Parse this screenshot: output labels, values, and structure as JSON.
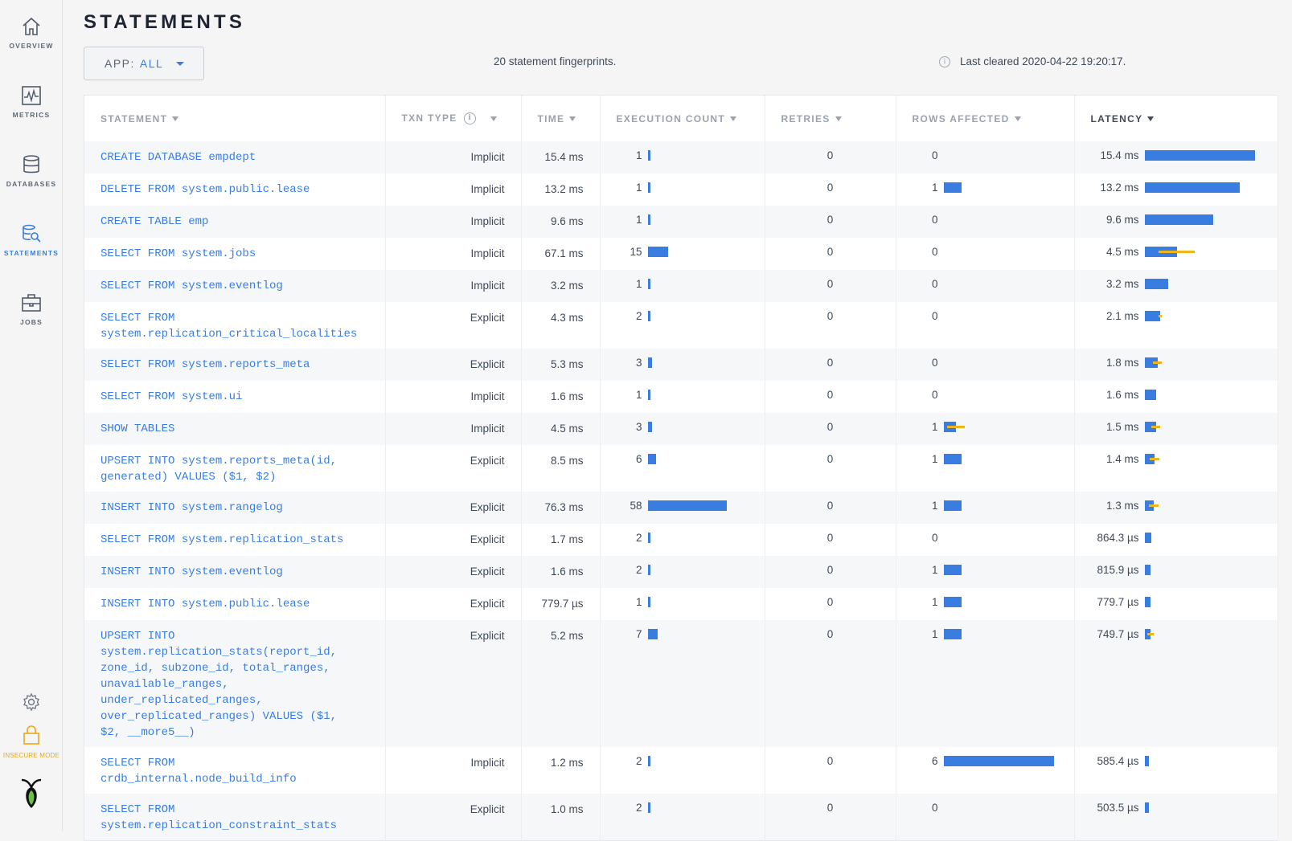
{
  "sidebar": {
    "items": [
      {
        "label": "OVERVIEW",
        "icon": "home-icon"
      },
      {
        "label": "METRICS",
        "icon": "metrics-icon"
      },
      {
        "label": "DATABASES",
        "icon": "database-icon"
      },
      {
        "label": "STATEMENTS",
        "icon": "statements-icon"
      },
      {
        "label": "JOBS",
        "icon": "jobs-icon"
      }
    ],
    "insecure_label": "INSECURE MODE",
    "accent": "#3a7de1",
    "warning": "#e9a81a"
  },
  "page": {
    "title": "STATEMENTS",
    "app_select_label": "APP:",
    "app_select_value": "ALL",
    "fingerprints": "20 statement fingerprints.",
    "cleared": "Last cleared 2020-04-22 19:20:17."
  },
  "table": {
    "headers": [
      "STATEMENT",
      "TXN TYPE",
      "TIME",
      "EXECUTION COUNT",
      "RETRIES",
      "ROWS AFFECTED",
      "LATENCY"
    ],
    "active_sort": "LATENCY",
    "rows": [
      {
        "statement": "CREATE DATABASE empdept",
        "txn": "Implicit",
        "time": "15.4 ms",
        "count": "1",
        "count_frac": 0.01,
        "retries": "0",
        "rows": "0",
        "rows_frac": 0,
        "rows_dev": 0,
        "latency": "15.4 ms",
        "lat_frac": 1.0,
        "lat_dev": 0
      },
      {
        "statement": "DELETE FROM system.public.lease",
        "txn": "Implicit",
        "time": "13.2 ms",
        "count": "1",
        "count_frac": 0.01,
        "retries": "0",
        "rows": "1",
        "rows_frac": 0.16,
        "rows_dev": 0,
        "latency": "13.2 ms",
        "lat_frac": 0.86,
        "lat_dev": 0
      },
      {
        "statement": "CREATE TABLE emp",
        "txn": "Implicit",
        "time": "9.6 ms",
        "count": "1",
        "count_frac": 0.01,
        "retries": "0",
        "rows": "0",
        "rows_frac": 0,
        "rows_dev": 0,
        "latency": "9.6 ms",
        "lat_frac": 0.62,
        "lat_dev": 0
      },
      {
        "statement": "SELECT FROM system.jobs",
        "txn": "Implicit",
        "time": "67.1 ms",
        "count": "15",
        "count_frac": 0.26,
        "retries": "0",
        "rows": "0",
        "rows_frac": 0,
        "rows_dev": 0,
        "latency": "4.5 ms",
        "lat_frac": 0.29,
        "lat_dev": 0.33
      },
      {
        "statement": "SELECT FROM system.eventlog",
        "txn": "Implicit",
        "time": "3.2 ms",
        "count": "1",
        "count_frac": 0.01,
        "retries": "0",
        "rows": "0",
        "rows_frac": 0,
        "rows_dev": 0,
        "latency": "3.2 ms",
        "lat_frac": 0.21,
        "lat_dev": 0
      },
      {
        "statement": "SELECT FROM\nsystem.replication_critical_localities",
        "txn": "Explicit",
        "time": "4.3 ms",
        "count": "2",
        "count_frac": 0.02,
        "retries": "0",
        "rows": "0",
        "rows_frac": 0,
        "rows_dev": 0,
        "latency": "2.1 ms",
        "lat_frac": 0.14,
        "lat_dev": 0.03
      },
      {
        "statement": "SELECT FROM system.reports_meta",
        "txn": "Explicit",
        "time": "5.3 ms",
        "count": "3",
        "count_frac": 0.05,
        "retries": "0",
        "rows": "0",
        "rows_frac": 0,
        "rows_dev": 0,
        "latency": "1.8 ms",
        "lat_frac": 0.12,
        "lat_dev": 0.08
      },
      {
        "statement": "SELECT FROM system.ui",
        "txn": "Implicit",
        "time": "1.6 ms",
        "count": "1",
        "count_frac": 0.01,
        "retries": "0",
        "rows": "0",
        "rows_frac": 0,
        "rows_dev": 0,
        "latency": "1.6 ms",
        "lat_frac": 0.1,
        "lat_dev": 0
      },
      {
        "statement": "SHOW TABLES",
        "txn": "Implicit",
        "time": "4.5 ms",
        "count": "3",
        "count_frac": 0.05,
        "retries": "0",
        "rows": "1",
        "rows_frac": 0.11,
        "rows_dev": 0.16,
        "latency": "1.5 ms",
        "lat_frac": 0.1,
        "lat_dev": 0.08
      },
      {
        "statement": "UPSERT INTO system.reports_meta(id,\ngenerated) VALUES ($1, $2)",
        "txn": "Explicit",
        "time": "8.5 ms",
        "count": "6",
        "count_frac": 0.1,
        "retries": "0",
        "rows": "1",
        "rows_frac": 0.16,
        "rows_dev": 0,
        "latency": "1.4 ms",
        "lat_frac": 0.09,
        "lat_dev": 0.09
      },
      {
        "statement": "INSERT INTO system.rangelog",
        "txn": "Explicit",
        "time": "76.3 ms",
        "count": "58",
        "count_frac": 1.0,
        "retries": "0",
        "rows": "1",
        "rows_frac": 0.16,
        "rows_dev": 0,
        "latency": "1.3 ms",
        "lat_frac": 0.08,
        "lat_dev": 0.09
      },
      {
        "statement": "SELECT FROM system.replication_stats",
        "txn": "Explicit",
        "time": "1.7 ms",
        "count": "2",
        "count_frac": 0.02,
        "retries": "0",
        "rows": "0",
        "rows_frac": 0,
        "rows_dev": 0,
        "latency": "864.3 µs",
        "lat_frac": 0.056,
        "lat_dev": 0
      },
      {
        "statement": "INSERT INTO system.eventlog",
        "txn": "Explicit",
        "time": "1.6 ms",
        "count": "2",
        "count_frac": 0.02,
        "retries": "0",
        "rows": "1",
        "rows_frac": 0.16,
        "rows_dev": 0,
        "latency": "815.9 µs",
        "lat_frac": 0.053,
        "lat_dev": 0
      },
      {
        "statement": "INSERT INTO system.public.lease",
        "txn": "Explicit",
        "time": "779.7 µs",
        "count": "1",
        "count_frac": 0.01,
        "retries": "0",
        "rows": "1",
        "rows_frac": 0.16,
        "rows_dev": 0,
        "latency": "779.7 µs",
        "lat_frac": 0.05,
        "lat_dev": 0
      },
      {
        "statement": "UPSERT INTO\nsystem.replication_stats(report_id,\nzone_id, subzone_id, total_ranges,\nunavailable_ranges,\nunder_replicated_ranges,\nover_replicated_ranges) VALUES ($1,\n$2, __more5__)",
        "txn": "Explicit",
        "time": "5.2 ms",
        "count": "7",
        "count_frac": 0.12,
        "retries": "0",
        "rows": "1",
        "rows_frac": 0.16,
        "rows_dev": 0,
        "latency": "749.7 µs",
        "lat_frac": 0.049,
        "lat_dev": 0.06
      },
      {
        "statement": "SELECT FROM\ncrdb_internal.node_build_info",
        "txn": "Implicit",
        "time": "1.2 ms",
        "count": "2",
        "count_frac": 0.02,
        "retries": "0",
        "rows": "6",
        "rows_frac": 1.0,
        "rows_dev": 0,
        "latency": "585.4 µs",
        "lat_frac": 0.038,
        "lat_dev": 0
      },
      {
        "statement": "SELECT FROM\nsystem.replication_constraint_stats",
        "txn": "Explicit",
        "time": "1.0 ms",
        "count": "2",
        "count_frac": 0.02,
        "retries": "0",
        "rows": "0",
        "rows_frac": 0,
        "rows_dev": 0,
        "latency": "503.5 µs",
        "lat_frac": 0.033,
        "lat_dev": 0
      }
    ]
  }
}
